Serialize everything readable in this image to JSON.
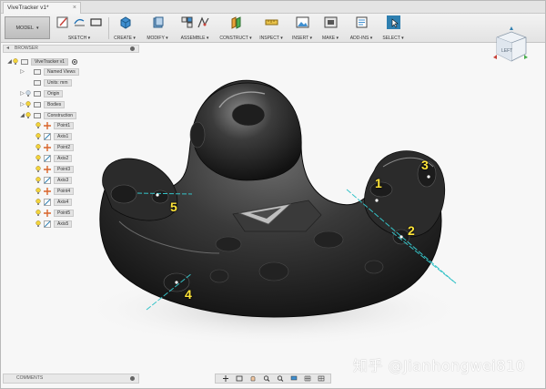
{
  "document_tab": {
    "title": "ViveTracker v1*",
    "close": "×"
  },
  "ribbon": {
    "workspace": "MODEL",
    "groups": [
      {
        "label": "SKETCH ▾"
      },
      {
        "label": "CREATE ▾"
      },
      {
        "label": "MODIFY ▾"
      },
      {
        "label": "ASSEMBLE ▾"
      },
      {
        "label": "CONSTRUCT ▾"
      },
      {
        "label": "INSPECT ▾"
      },
      {
        "label": "INSERT ▾"
      },
      {
        "label": "MAKE ▾"
      },
      {
        "label": "ADD-INS ▾"
      },
      {
        "label": "SELECT ▾"
      }
    ]
  },
  "viewcube": {
    "face": "LEFT"
  },
  "browser": {
    "header": "BROWSER",
    "root": "ViveTracker v1",
    "items": [
      {
        "label": "Named Views"
      },
      {
        "label": "Units: mm"
      },
      {
        "label": "Origin"
      },
      {
        "label": "Bodies"
      },
      {
        "label": "Construction"
      }
    ],
    "construction_items": [
      {
        "label": "Point1",
        "kind": "point"
      },
      {
        "label": "Axis1",
        "kind": "axis"
      },
      {
        "label": "Point2",
        "kind": "point"
      },
      {
        "label": "Axis2",
        "kind": "axis"
      },
      {
        "label": "Point3",
        "kind": "point"
      },
      {
        "label": "Axis3",
        "kind": "axis"
      },
      {
        "label": "Point4",
        "kind": "point"
      },
      {
        "label": "Axis4",
        "kind": "axis"
      },
      {
        "label": "Point5",
        "kind": "point"
      },
      {
        "label": "Axis5",
        "kind": "axis"
      }
    ]
  },
  "callouts": [
    "1",
    "2",
    "3",
    "4",
    "5"
  ],
  "comments": {
    "label": "COMMENTS"
  },
  "watermark": "知乎 @Jianhongwei810",
  "colors": {
    "accent": "#2e7fb0",
    "callout": "#ffe53a",
    "axis_line": "#35c3c8",
    "body": "#2a2a2a"
  }
}
